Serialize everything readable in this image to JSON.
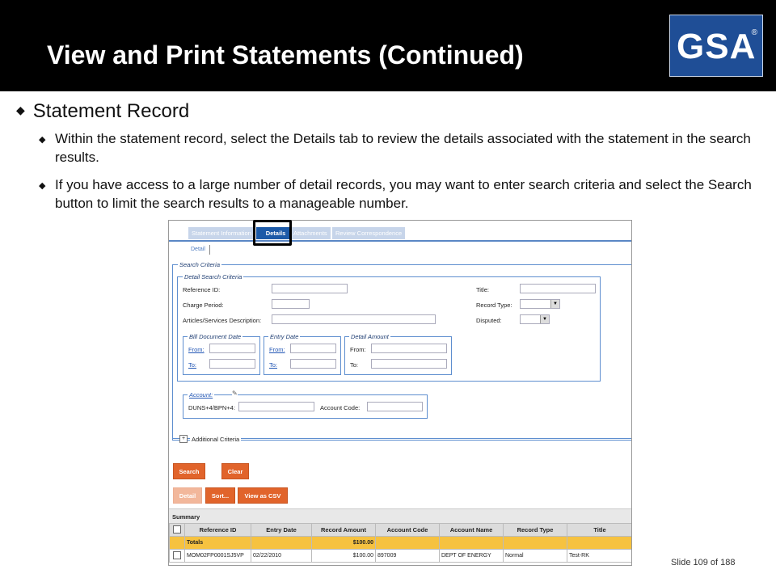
{
  "slide": {
    "title": "View and Print Statements (Continued)",
    "logo_text": "GSA",
    "logo_mark": "®",
    "bullet_main": "Statement Record",
    "bullet_sub1": "Within the statement record, select the Details tab to review the details associated with the statement in the search results.",
    "bullet_sub2": "If you have access to a large number of detail records, you may want to enter search criteria and select the Search button to limit the search results to a manageable number.",
    "footer": "Slide 109 of 188"
  },
  "screen": {
    "tabs": [
      "Statement Information",
      "Details",
      "Attachments",
      "Review Correspondence"
    ],
    "active_tab": "Details",
    "detail_link": "Detail",
    "search_criteria_legend": "Search Criteria",
    "detail_search_legend": "Detail Search Criteria",
    "labels": {
      "reference_id": "Reference ID:",
      "charge_period": "Charge Period:",
      "articles": "Articles/Services Description:",
      "title": "Title:",
      "record_type": "Record Type:",
      "disputed": "Disputed:",
      "bill_doc_date": "Bill Document Date",
      "entry_date": "Entry Date",
      "detail_amount": "Detail Amount",
      "from_link": "From:",
      "to_link": "To:",
      "from": "From:",
      "to": "To:",
      "account": "Account:",
      "duns": "DUNS+4/BPN+4:",
      "account_code": "Account Code:",
      "additional_criteria": "Additional Criteria"
    },
    "buttons": {
      "search": "Search",
      "clear": "Clear",
      "detail": "Detail",
      "sort": "Sort...",
      "csv": "View as CSV"
    },
    "summary_label": "Summary",
    "table": {
      "headers": [
        "Reference ID",
        "Entry Date",
        "Record Amount",
        "Account Code",
        "Account Name",
        "Record Type",
        "Title"
      ],
      "totals": {
        "label": "Totals",
        "amount": "$100.00"
      },
      "row": {
        "ref": "MOM02FP0001SJ5VP",
        "date": "02/22/2010",
        "amount": "$100.00",
        "code": "897009",
        "name": "DEPT OF ENERGY",
        "type": "Normal",
        "title": "Test-RK"
      }
    }
  }
}
